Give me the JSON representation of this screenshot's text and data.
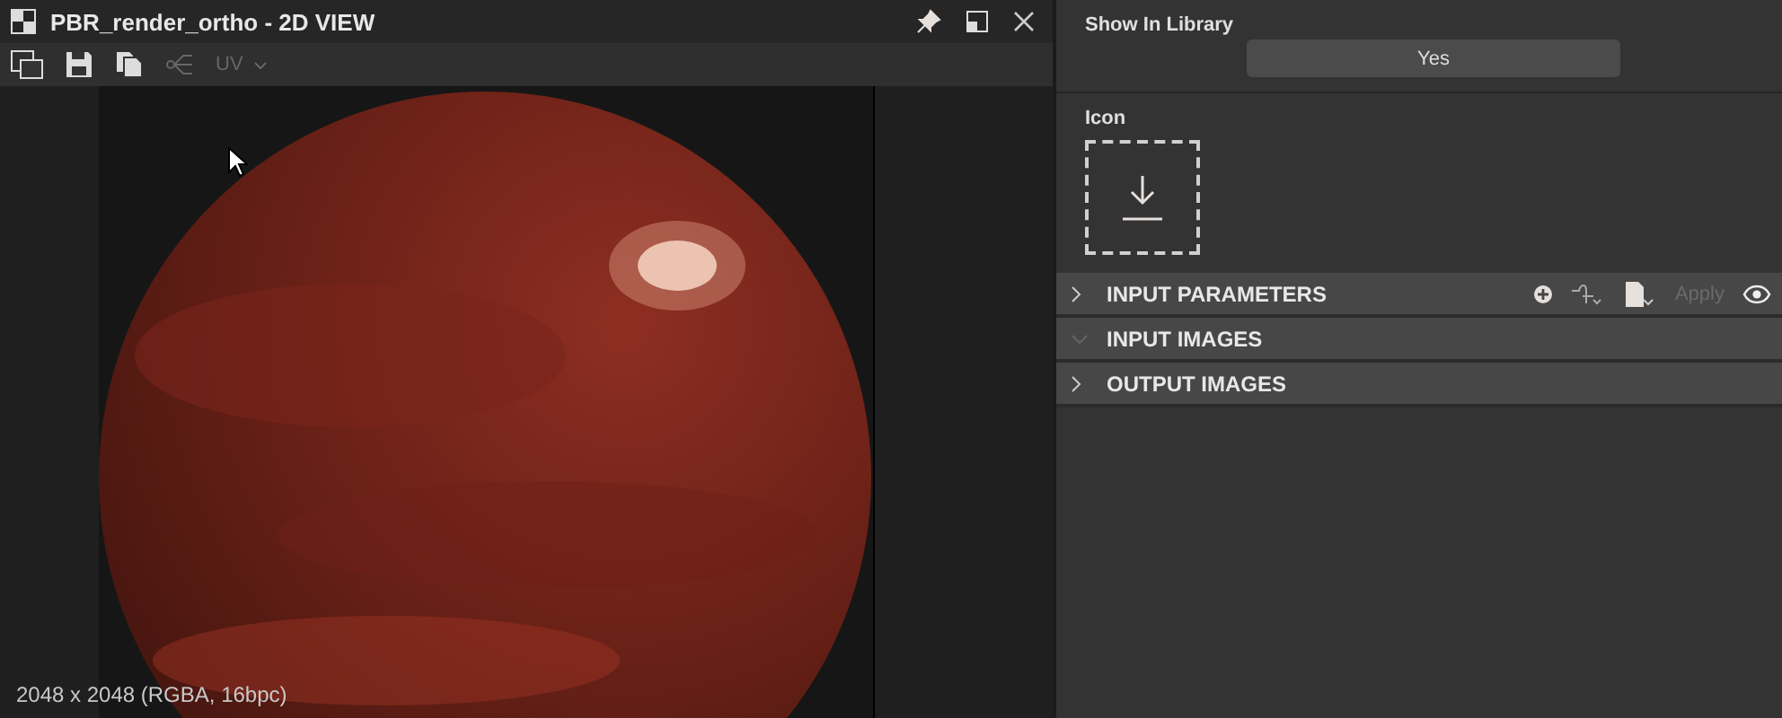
{
  "window": {
    "title": "PBR_render_ortho - 2D VIEW"
  },
  "toolbar": {
    "uv_dropdown": {
      "label": "UV",
      "disabled": true
    }
  },
  "viewport": {
    "status": "2048 x 2048 (RGBA, 16bpc)"
  },
  "properties": {
    "show_in_library": {
      "label": "Show In Library",
      "value": "Yes"
    },
    "icon": {
      "label": "Icon"
    }
  },
  "sections": [
    {
      "title": "INPUT PARAMETERS",
      "expanded": false,
      "apply": {
        "label": "Apply",
        "disabled": true
      }
    },
    {
      "title": "INPUT IMAGES",
      "expanded": true
    },
    {
      "title": "OUTPUT IMAGES",
      "expanded": false
    }
  ]
}
